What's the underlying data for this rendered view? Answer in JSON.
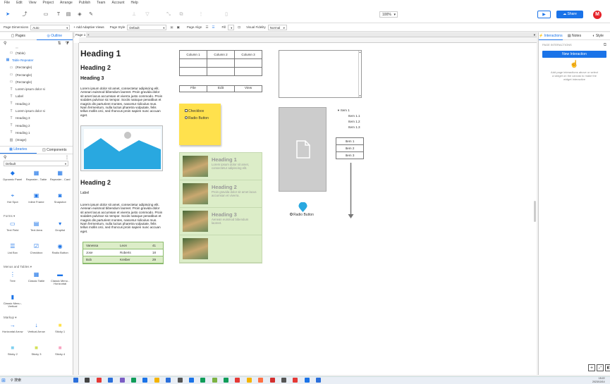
{
  "menubar": [
    "File",
    "Edit",
    "View",
    "Project",
    "Arrange",
    "Publish",
    "Team",
    "Account",
    "Help"
  ],
  "toolbar": {
    "zoom": "100%",
    "share": "Share",
    "avatar": "M"
  },
  "options": {
    "page_dimensions_label": "Page Dimensions",
    "page_dimensions_value": "Auto",
    "adaptive_views": "+ Add Adaptive Views",
    "page_style_label": "Page Style",
    "page_style_value": "Default",
    "page_align_label": "Page Align",
    "fill_label": "Fill",
    "visual_fidelity_label": "Visual Fidelity",
    "visual_fidelity_value": "Normal"
  },
  "leftpanel": {
    "tabs": [
      "Pages",
      "Outline"
    ],
    "outline": [
      {
        "icon": "box",
        "label": "(Table)"
      },
      {
        "icon": "table",
        "label": "Table Repeater",
        "accent": true
      },
      {
        "icon": "rect",
        "label": "(Rectangle)"
      },
      {
        "icon": "rect",
        "label": "(Rectangle)"
      },
      {
        "icon": "rect",
        "label": "(Rectangle)"
      },
      {
        "icon": "text",
        "label": "Lorem ipsum dolor si"
      },
      {
        "icon": "text",
        "label": "Label"
      },
      {
        "icon": "text",
        "label": "Heading 2"
      },
      {
        "icon": "text",
        "label": "Lorem ipsum dolor si"
      },
      {
        "icon": "text",
        "label": "Heading 3"
      },
      {
        "icon": "text",
        "label": "Heading 2"
      },
      {
        "icon": "text",
        "label": "Heading 1"
      },
      {
        "icon": "image",
        "label": "(Image)"
      }
    ],
    "lib_tabs": [
      "Libraries",
      "Components"
    ],
    "lib_select": "Default",
    "lib_top": [
      {
        "icon": "layers",
        "label": "Dynamic Panel"
      },
      {
        "icon": "grid",
        "label": "Repeater - Table"
      },
      {
        "icon": "grid",
        "label": "Repeater - Card"
      },
      {
        "icon": "hotspot",
        "label": "Hot Spot"
      },
      {
        "icon": "frame",
        "label": "Inline Frame"
      },
      {
        "icon": "camera",
        "label": "Snapshot"
      }
    ],
    "forms_label": "Forms ▾",
    "forms": [
      {
        "icon": "field",
        "label": "Text Field"
      },
      {
        "icon": "area",
        "label": "Text Area"
      },
      {
        "icon": "droplist",
        "label": "Droplist"
      },
      {
        "icon": "listbox",
        "label": "List Box"
      },
      {
        "icon": "check",
        "label": "Checkbox"
      },
      {
        "icon": "radio",
        "label": "Radio Button"
      }
    ],
    "menus_label": "Menus and Tables ▾",
    "menus": [
      {
        "icon": "tree",
        "label": "Tree"
      },
      {
        "icon": "table",
        "label": "Classic Table"
      },
      {
        "icon": "menu-h",
        "label": "Classic Menu - Horizontal"
      },
      {
        "icon": "menu-v",
        "label": "Classic Menu - Vertical"
      }
    ],
    "markup_label": "Markup ▾",
    "markup": [
      {
        "icon": "arrow-h",
        "label": "Horizontal Arrow"
      },
      {
        "icon": "arrow-v",
        "label": "Vertical Arrow"
      },
      {
        "icon": "sticky1",
        "label": "Sticky 1"
      },
      {
        "icon": "sticky2",
        "label": "Sticky 2"
      },
      {
        "icon": "sticky3",
        "label": "Sticky 3"
      },
      {
        "icon": "sticky4",
        "label": "Sticky 4"
      }
    ]
  },
  "page_tab": "Page 1",
  "canvas": {
    "h1": "Heading 1",
    "h2": "Heading 2",
    "h3": "Heading 3",
    "para1": "Lorem ipsum dolor sit amet, consectetur adipiscing elit. Aenean euismod bibendum laoreet. Proin gravida dolor sit amet lacus accumsan et viverra justo commodo. Proin sodales pulvinar sic tempor. Sociis natoque penatibus et magnis dis parturient montes, nascetur ridiculus mus. Nam fermentum, nulla luctus pharetra vulputate, felis tellus mollis orci, sed rhoncus proin sapien nunc accuan eget.",
    "h2b": "Heading 2",
    "label": "Label",
    "para2": "Lorem ipsum dolor sit amet, consectetur adipiscing elit. Aenean euismod bibendum laoreet. Proin gravida dolor sit amet lacus accumsan et viverra justo commodo. Proin sodales pulvinar sic tempor. Sociis natoque penatibus et magnis dis parturient montes, nascetur ridiculus mus. Nam fermentum, nulla luctus pharetra vulputate, felis tellus mollis orci, sed rhoncus proin sapien nunc accuan eget.",
    "rep_table": [
      [
        "Vanessa",
        "Leon",
        "41"
      ],
      [
        "Jose",
        "Roberts",
        "18"
      ],
      [
        "Bob",
        "Kreiber",
        "29"
      ]
    ],
    "table_headers": [
      "Column 1",
      "Column 2",
      "Column 3"
    ],
    "menu_buttons": [
      "File",
      "Edit",
      "View"
    ],
    "sticky_checkbox": "Checkbox",
    "sticky_radio": "Radio Button",
    "cards": [
      {
        "h": "Heading 1",
        "t": "Lorem ipsum dolor sit amet, consectetur adipiscing elit."
      },
      {
        "h": "Heading 2",
        "t": "Proin gravida dolor sit amet lacus accumsan et viverra."
      },
      {
        "h": "Heading 3",
        "t": "Aenean euismod bibendum laoreet."
      }
    ],
    "radio_button": "Radio Button",
    "tree": [
      "Item 1",
      "Item 1.1",
      "Item 1.2",
      "Item 1.3"
    ],
    "vmenu": [
      "Item 1",
      "Item 2",
      "Item 3"
    ]
  },
  "rightpanel": {
    "tabs": [
      "Interactions",
      "Notes",
      "Style"
    ],
    "section": "PAGE INTERACTIONS",
    "new_button": "New Interaction",
    "hint": "Add page interactions above or select a widget on the canvas to make the widget interactive"
  },
  "taskbar": {
    "search": "搜索",
    "time": "15:22",
    "date": "2023/10/14"
  },
  "colors": {
    "accent": "#1a73e8",
    "sticky": "#ffe14d",
    "repeater": "#dcedc8",
    "image": "#29a8e0"
  }
}
